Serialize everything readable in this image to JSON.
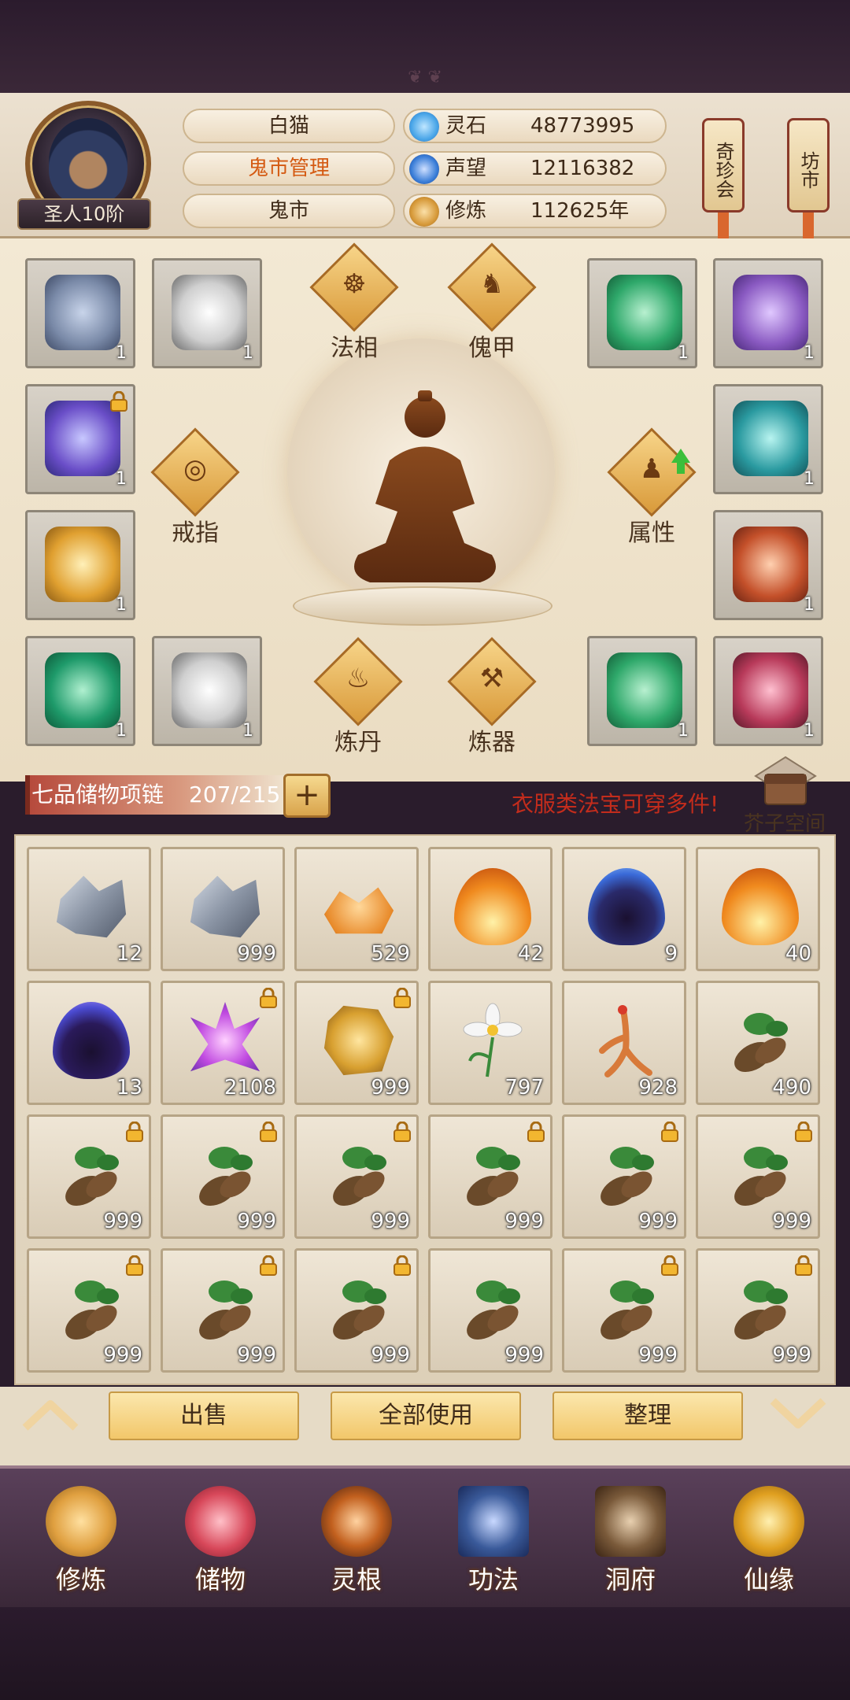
{
  "player": {
    "name": "白猫",
    "rank": "圣人10阶",
    "role": "鬼市管理",
    "location": "鬼市"
  },
  "resources": [
    {
      "name": "灵石",
      "value": "48773995",
      "icon": "blue-crystal-icon",
      "color": "#4aa6e8"
    },
    {
      "name": "声望",
      "value": "12116382",
      "icon": "blue-flame-icon",
      "color": "#3b7ed8"
    },
    {
      "name": "修炼",
      "value": "112625年",
      "icon": "meditation-icon",
      "color": "#d79a3a"
    }
  ],
  "side_buttons": {
    "qizhenhui": "奇珍会",
    "fangshi": "坊市"
  },
  "equipment_slots": [
    {
      "icon": "armor-icon",
      "count": "1",
      "color": "#7a8aa8",
      "locked": false
    },
    {
      "icon": "white-tiger-icon",
      "count": "1",
      "color": "#e6e6e6",
      "locked": false
    },
    {
      "icon": "jade-dragon-icon",
      "count": "1",
      "color": "#2ea86a",
      "locked": false
    },
    {
      "icon": "purple-boots-icon",
      "count": "1",
      "color": "#8a5ac2",
      "locked": false
    },
    {
      "icon": "purple-boots-icon",
      "count": "1",
      "color": "#6a4ec8",
      "locked": true
    },
    {
      "icon": "teal-boots-icon",
      "count": "1",
      "color": "#2a9aa0",
      "locked": false
    },
    {
      "icon": "golden-boots-icon",
      "count": "1",
      "color": "#e0a030",
      "locked": false
    },
    {
      "icon": "red-gold-boots-icon",
      "count": "1",
      "color": "#c4502a",
      "locked": false
    },
    {
      "icon": "green-boots-icon",
      "count": "1",
      "color": "#1e9a6a",
      "locked": false
    },
    {
      "icon": "white-tiger-icon",
      "count": "1",
      "color": "#e6e6e6",
      "locked": false
    },
    {
      "icon": "jade-dragon-icon",
      "count": "1",
      "color": "#2ea86a",
      "locked": false
    },
    {
      "icon": "crimson-boots-icon",
      "count": "1",
      "color": "#b83a5a",
      "locked": false
    }
  ],
  "equip_categories": {
    "faxiang": "法相",
    "kuijia": "傀甲",
    "jiezhi": "戒指",
    "shuxing": "属性",
    "liandan": "炼丹",
    "lianqi": "炼器"
  },
  "storage": {
    "label": "七品储物项链",
    "count": "207/215",
    "plus": "+",
    "hint": "衣服类法宝可穿多件!",
    "chest_label": "芥子空间"
  },
  "bag_items": [
    {
      "icon": "iron-ore-icon",
      "count": "12",
      "color": "#8c96a6",
      "locked": false
    },
    {
      "icon": "iron-ore-icon",
      "count": "999",
      "color": "#8c96a6",
      "locked": false
    },
    {
      "icon": "amber-ore-icon",
      "count": "529",
      "color": "#e88a2a",
      "locked": false
    },
    {
      "icon": "fire-icon",
      "count": "42",
      "color": "#f08a1e",
      "locked": false
    },
    {
      "icon": "dark-flame-icon",
      "count": "9",
      "color": "#3a6ad8",
      "locked": false
    },
    {
      "icon": "fire-icon",
      "count": "40",
      "color": "#f08a1e",
      "locked": false
    },
    {
      "icon": "dark-flame-icon",
      "count": "13",
      "color": "#4a4ad0",
      "locked": false
    },
    {
      "icon": "purple-crystal-icon",
      "count": "2108",
      "color": "#c04ae0",
      "locked": true
    },
    {
      "icon": "gold-ore-icon",
      "count": "999",
      "color": "#d8a030",
      "locked": true
    },
    {
      "icon": "white-flower-icon",
      "count": "797",
      "color": "#f2f2f2",
      "locked": false
    },
    {
      "icon": "ginseng-icon",
      "count": "928",
      "color": "#d87a3a",
      "locked": false
    },
    {
      "icon": "herb-root-icon",
      "count": "490",
      "color": "#6a4a2a",
      "locked": false
    },
    {
      "icon": "herb-root-icon",
      "count": "999",
      "color": "#6a4a2a",
      "locked": true
    },
    {
      "icon": "herb-root-icon",
      "count": "999",
      "color": "#6a4a2a",
      "locked": true
    },
    {
      "icon": "herb-root-icon",
      "count": "999",
      "color": "#6a4a2a",
      "locked": true
    },
    {
      "icon": "herb-root-icon",
      "count": "999",
      "color": "#6a4a2a",
      "locked": true
    },
    {
      "icon": "herb-root-icon",
      "count": "999",
      "color": "#6a4a2a",
      "locked": true
    },
    {
      "icon": "herb-root-icon",
      "count": "999",
      "color": "#6a4a2a",
      "locked": true
    },
    {
      "icon": "herb-root-icon",
      "count": "999",
      "color": "#6a4a2a",
      "locked": true
    },
    {
      "icon": "herb-root-icon",
      "count": "999",
      "color": "#6a4a2a",
      "locked": true
    },
    {
      "icon": "herb-root-icon",
      "count": "999",
      "color": "#6a4a2a",
      "locked": true
    },
    {
      "icon": "herb-root-icon",
      "count": "999",
      "color": "#6a4a2a",
      "locked": false
    },
    {
      "icon": "herb-root-icon",
      "count": "999",
      "color": "#6a4a2a",
      "locked": true
    },
    {
      "icon": "herb-root-icon",
      "count": "999",
      "color": "#6a4a2a",
      "locked": true
    }
  ],
  "actions": {
    "sell": "出售",
    "use_all": "全部使用",
    "sort": "整理"
  },
  "nav": [
    {
      "label": "修炼",
      "icon": "cultivator-icon",
      "color": "#e0a040"
    },
    {
      "label": "储物",
      "icon": "bag-icon",
      "color": "#d8485a"
    },
    {
      "label": "灵根",
      "icon": "spirit-root-icon",
      "color": "#c2601e"
    },
    {
      "label": "功法",
      "icon": "book-icon",
      "color": "#3a5a9a"
    },
    {
      "label": "洞府",
      "icon": "cave-dwelling-icon",
      "color": "#7a5a3a"
    },
    {
      "label": "仙缘",
      "icon": "gourd-icon",
      "color": "#e0a020"
    }
  ]
}
